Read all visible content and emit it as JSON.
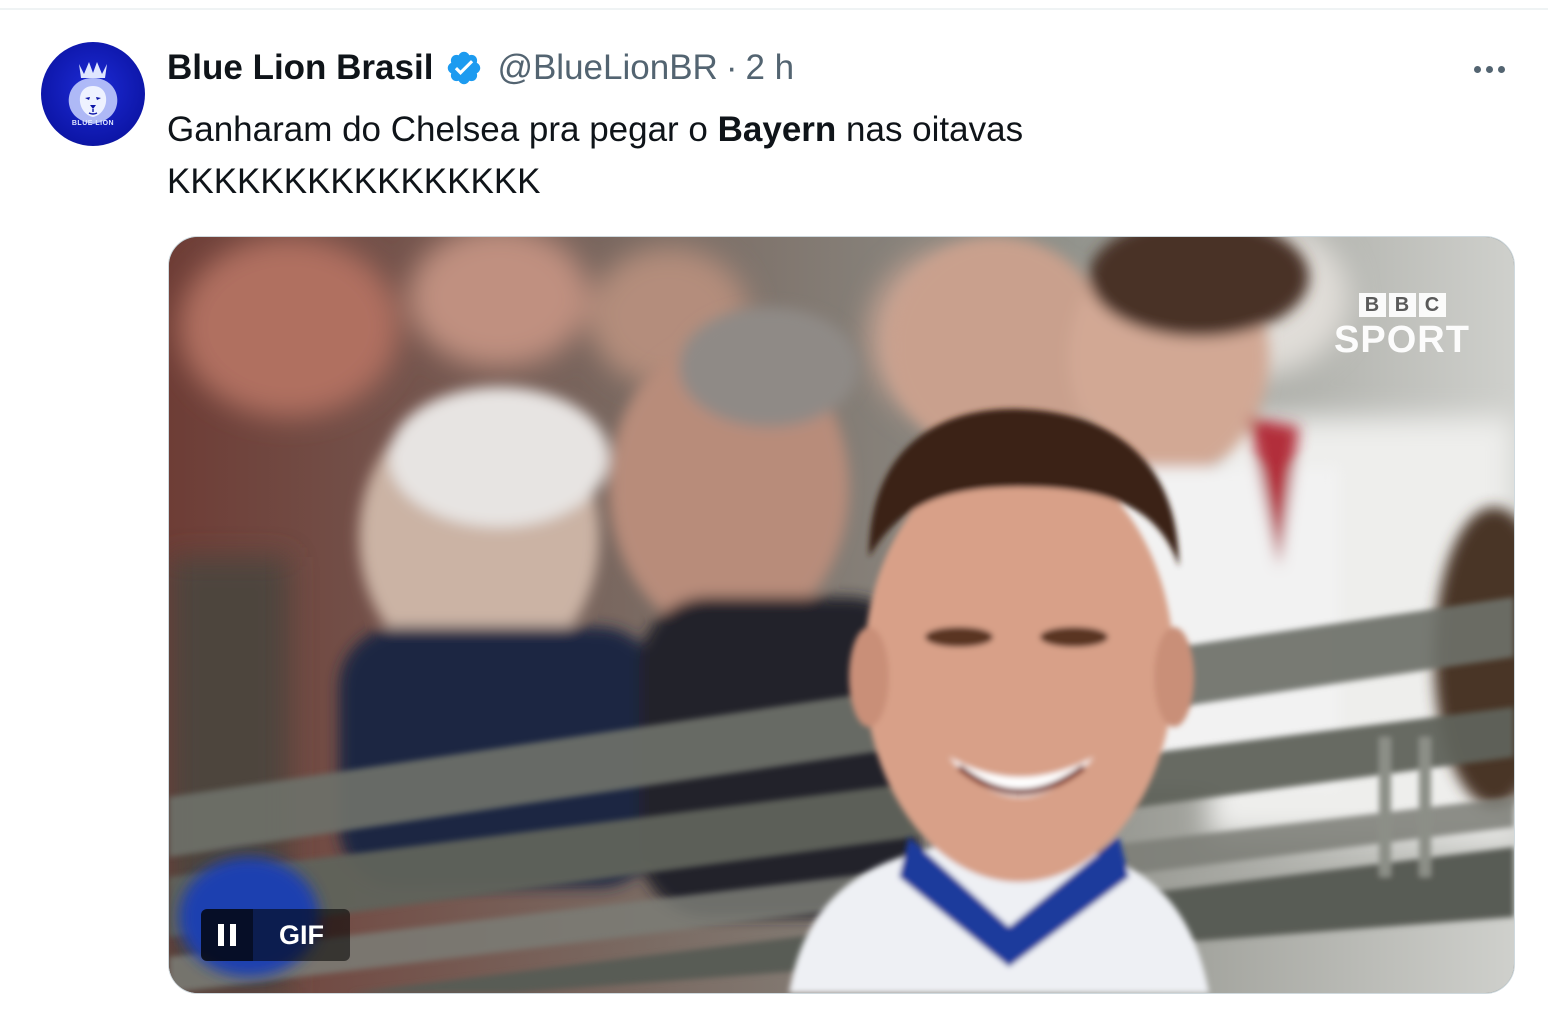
{
  "tweet": {
    "display_name": "Blue Lion Brasil",
    "handle": "@BlueLionBR",
    "separator": "·",
    "time": "2 h",
    "avatar_caption": "BLUE LION",
    "text_before": "Ganharam do Chelsea pra pegar o ",
    "text_bold": "Bayern",
    "text_after": " nas oitavas",
    "text_line2": "KKKKKKKKKKKKKKKK"
  },
  "icons": {
    "verified": "verified-badge-icon",
    "more": "more-options-icon",
    "pause": "pause-icon"
  },
  "media": {
    "type": "gif",
    "gif_label": "GIF",
    "watermark_letters": [
      "B",
      "B",
      "C"
    ],
    "watermark_word": "SPORT"
  },
  "colors": {
    "verified_blue": "#1d9bf0",
    "text_primary": "#0f1419",
    "text_secondary": "#536471",
    "avatar_blue": "#0d16a8"
  }
}
